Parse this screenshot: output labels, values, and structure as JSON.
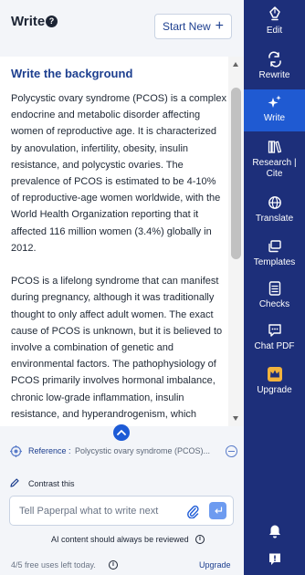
{
  "header": {
    "title": "Write",
    "start_new_label": "Start New"
  },
  "content": {
    "title": "Write the background",
    "paragraphs": [
      "Polycystic ovary syndrome (PCOS) is a complex endocrine and metabolic disorder affecting women of reproductive age. It is characterized by anovulation, infertility, obesity, insulin resistance, and polycystic ovaries. The prevalence of PCOS is estimated to be 4-10% of reproductive-age women worldwide, with the World Health Organization reporting that it affected 116 million women (3.4%) globally in 2012.",
      "PCOS is a lifelong syndrome that can manifest during pregnancy, although it was traditionally thought to only affect adult women. The exact cause of PCOS is unknown, but it is believed to involve a combination of genetic and environmental factors. The pathophysiology of PCOS primarily involves hormonal imbalance, chronic low-grade inflammation, insulin resistance, and hyperandrogenism, which"
    ]
  },
  "reference": {
    "label": "Reference :",
    "value": "Polycystic ovary syndrome (PCOS)..."
  },
  "contrast": {
    "label": "Contrast this"
  },
  "prompt": {
    "placeholder": "Tell Paperpal what to write next"
  },
  "disclaimer": "AI content should always be reviewed",
  "usage": {
    "text": "4/5 free uses left today.",
    "upgrade_label": "Upgrade"
  },
  "rail": {
    "items": [
      {
        "label": "Edit",
        "icon": "pen-nib-icon",
        "active": false
      },
      {
        "label": "Rewrite",
        "icon": "rewrite-arrows-icon",
        "active": false
      },
      {
        "label": "Write",
        "icon": "sparkle-icon",
        "active": true
      },
      {
        "label": "Research | Cite",
        "icon": "books-icon",
        "active": false
      },
      {
        "label": "Translate",
        "icon": "globe-icon",
        "active": false
      },
      {
        "label": "Templates",
        "icon": "templates-icon",
        "active": false
      },
      {
        "label": "Checks",
        "icon": "checklist-icon",
        "active": false
      },
      {
        "label": "Chat PDF",
        "icon": "chat-icon",
        "active": false
      },
      {
        "label": "Upgrade",
        "icon": "crown-icon",
        "active": false
      }
    ],
    "bottom_icons": [
      "bell-icon",
      "feedback-icon"
    ]
  },
  "colors": {
    "rail": "#1d2f7a",
    "active": "#1f5ad2",
    "accent": "#1d3f8f",
    "send": "#6d9bf0",
    "crown": "#f2b33d"
  }
}
